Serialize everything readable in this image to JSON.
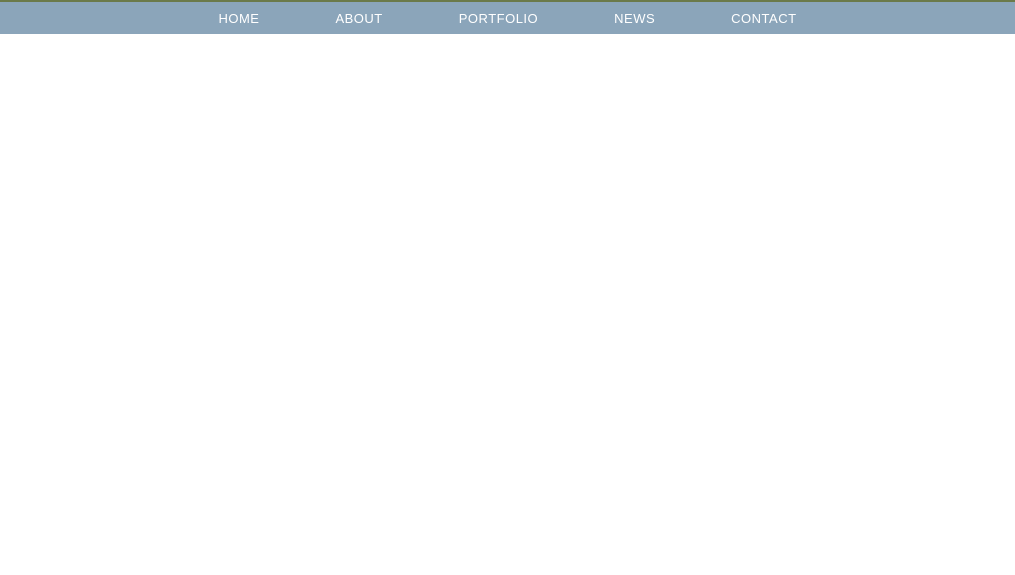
{
  "nav": {
    "items": [
      {
        "label": "HOME"
      },
      {
        "label": "ABOUT"
      },
      {
        "label": "PORTFOLIO"
      },
      {
        "label": "NEWS"
      },
      {
        "label": "CONTACT"
      }
    ]
  }
}
